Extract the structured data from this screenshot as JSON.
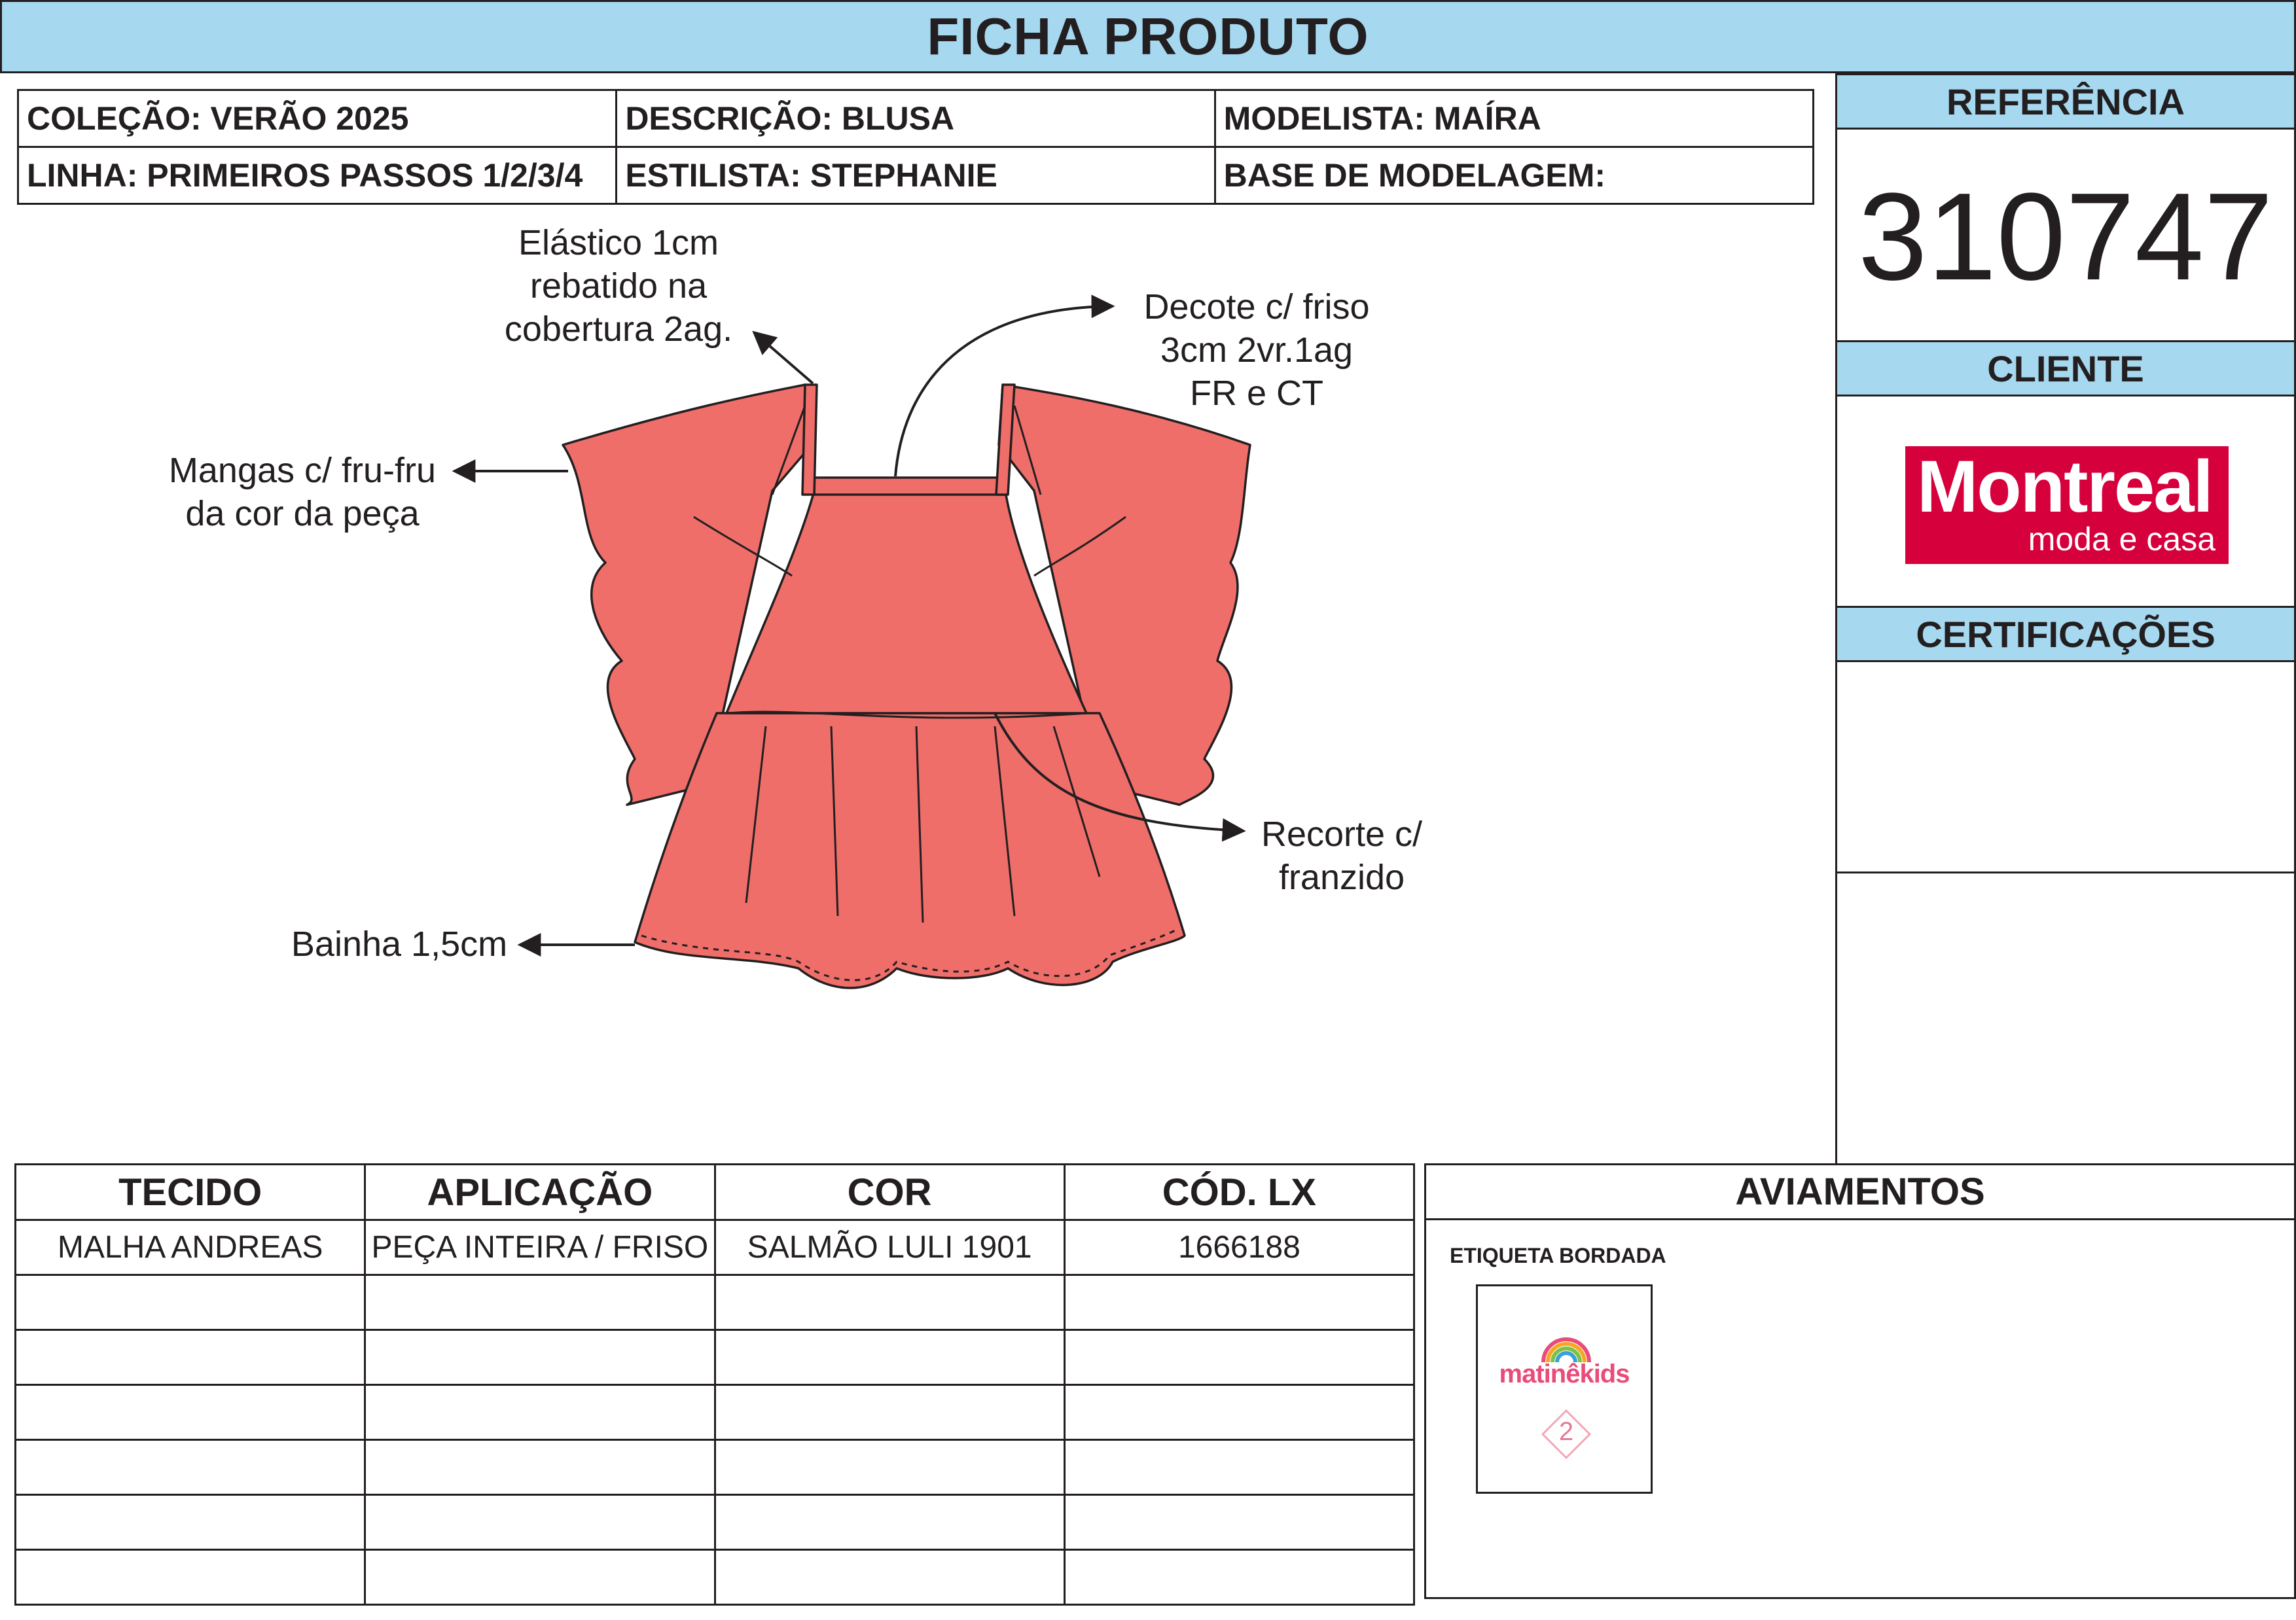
{
  "header": {
    "title": "FICHA PRODUTO"
  },
  "info": {
    "row1": [
      "COLEÇÃO: VERÃO 2025",
      "DESCRIÇÃO: BLUSA",
      "MODELISTA: MAÍRA"
    ],
    "row2": [
      "LINHA: PRIMEIROS PASSOS 1/2/3/4",
      "ESTILISTA: STEPHANIE",
      "BASE DE MODELAGEM:"
    ]
  },
  "side": {
    "referencia_label": "REFERÊNCIA",
    "referencia_value": "310747",
    "cliente_label": "CLIENTE",
    "certificacoes_label": "CERTIFICAÇÕES",
    "client_logo": {
      "main": "Montreal",
      "sub": "moda e casa",
      "color": "#d5003c"
    }
  },
  "annotations": {
    "elastico": [
      "Elástico 1cm",
      "rebatido na",
      "cobertura 2ag."
    ],
    "decote": [
      "Decote c/ friso",
      "3cm 2vr.1ag",
      "FR e CT"
    ],
    "mangas": [
      "Mangas c/ fru-fru",
      "da cor da peça"
    ],
    "recorte": [
      "Recorte c/",
      "franzido"
    ],
    "bainha": [
      "Bainha 1,5cm"
    ]
  },
  "garment": {
    "fill": "#ef6e6a",
    "stroke": "#231f20"
  },
  "materials": {
    "headers": [
      "TECIDO",
      "APLICAÇÃO",
      "COR",
      "CÓD. LX"
    ],
    "rows": [
      [
        "MALHA ANDREAS",
        "PEÇA INTEIRA / FRISO",
        "SALMÃO LULI 1901",
        "1666188"
      ],
      [
        "",
        "",
        "",
        ""
      ],
      [
        "",
        "",
        "",
        ""
      ],
      [
        "",
        "",
        "",
        ""
      ],
      [
        "",
        "",
        "",
        ""
      ],
      [
        "",
        "",
        "",
        ""
      ],
      [
        "",
        "",
        "",
        ""
      ]
    ]
  },
  "aviamentos": {
    "title": "AVIAMENTOS",
    "item_label": "ETIQUETA BORDADA",
    "label_brand": "matinêkids",
    "label_size": "2"
  },
  "colors": {
    "band": "#a6d8f0",
    "line": "#231f20"
  }
}
